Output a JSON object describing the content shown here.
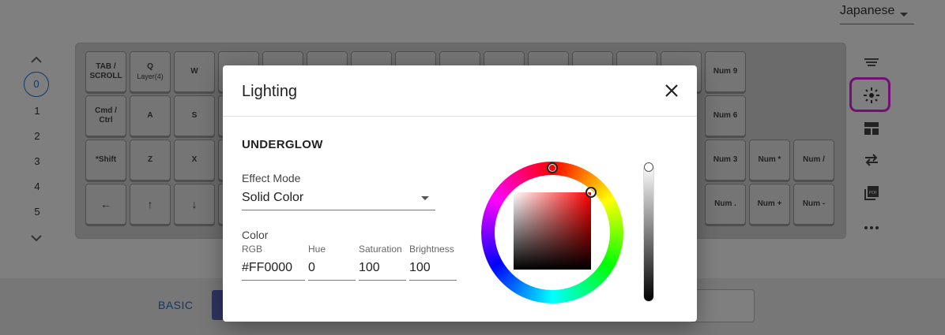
{
  "language": {
    "selected": "Japanese"
  },
  "layers": {
    "items": [
      "0",
      "1",
      "2",
      "3",
      "4",
      "5"
    ],
    "selected": "0"
  },
  "keyboard": {
    "keys": {
      "tab": [
        "TAB /",
        "SCROLL"
      ],
      "q": [
        "Q"
      ],
      "q_sub": "Layer(4)",
      "w": [
        "W"
      ],
      "cmd": [
        "Cmd /",
        "Ctrl"
      ],
      "a": [
        "A"
      ],
      "s": [
        "S"
      ],
      "shift": [
        "*Shift"
      ],
      "z": [
        "Z"
      ],
      "x": [
        "X"
      ],
      "left": [
        "←"
      ],
      "up": [
        "↑"
      ],
      "down": [
        "↓"
      ],
      "num9": [
        "Num 9"
      ],
      "num6": [
        "Num 6"
      ],
      "num3": [
        "Num 3"
      ],
      "num_star": [
        "Num *"
      ],
      "num_slash": [
        "Num /"
      ],
      "num_dot": [
        "Num ."
      ],
      "num_plus": [
        "Num +"
      ],
      "num_minus": [
        "Num -"
      ]
    }
  },
  "right_toolbar": {
    "icons": [
      "menu-lines-icon",
      "lighting-icon",
      "layout-icon",
      "swap-icon",
      "pdf-icon",
      "more-icon"
    ],
    "highlight_color": "#e91ee6"
  },
  "bottom": {
    "tab_basic": "BASIC"
  },
  "dialog": {
    "title": "Lighting",
    "section": "UNDERGLOW",
    "effect_mode_label": "Effect Mode",
    "effect_mode_value": "Solid Color",
    "color_label": "Color",
    "rgb_label": "RGB",
    "rgb_value": "#FF0000",
    "hue_label": "Hue",
    "hue_value": "0",
    "saturation_label": "Saturation",
    "saturation_value": "100",
    "brightness_label": "Brightness",
    "brightness_value": "100"
  },
  "colors": {
    "accent": "#1976d2",
    "selected_color": "#FF0000"
  }
}
